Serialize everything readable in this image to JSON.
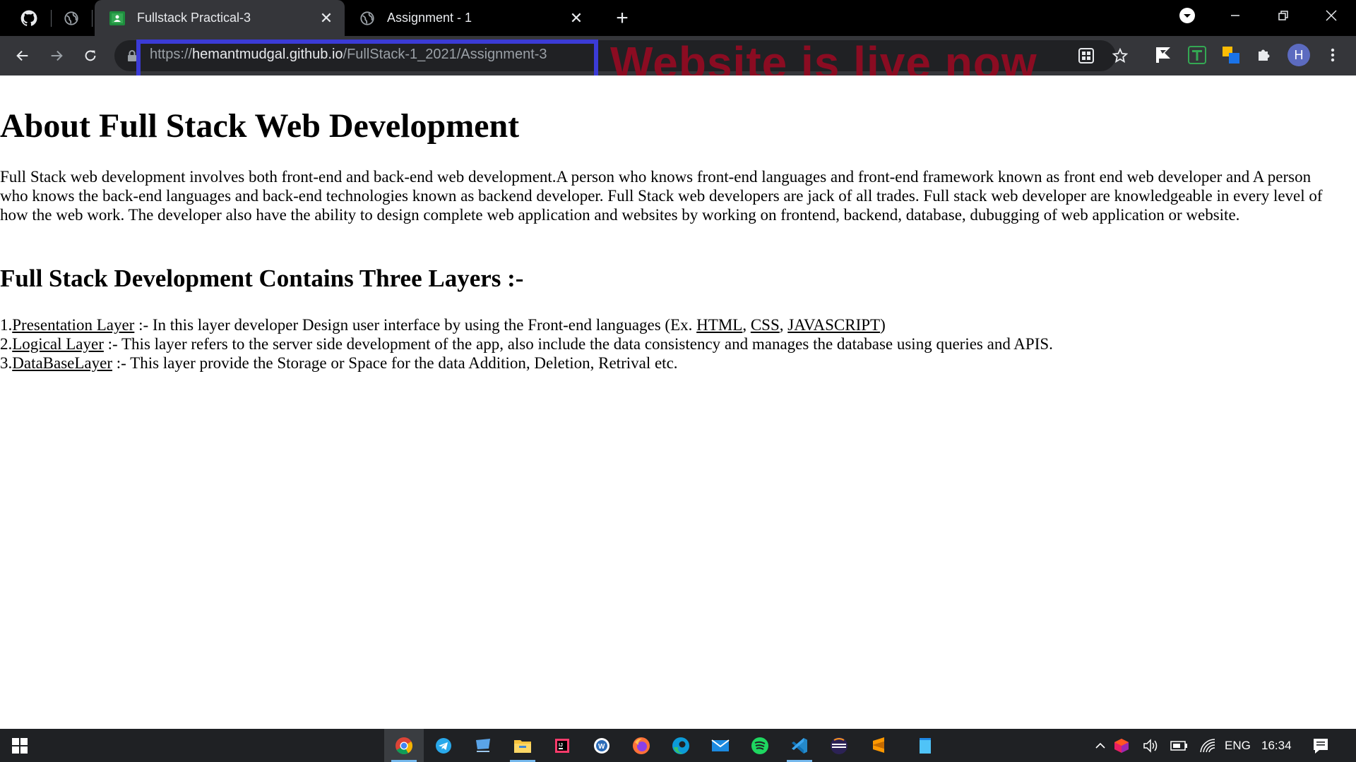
{
  "browser": {
    "tabs": [
      {
        "title": "Fullstack Practical-3",
        "favicon": "google-classroom-icon",
        "active": true
      },
      {
        "title": "Assignment - 1",
        "favicon": "globe-icon",
        "active": false
      }
    ],
    "pinned": [
      "github-icon",
      "globe-icon"
    ],
    "address": {
      "scheme": "https://",
      "host": "hemantmudgal.github.io",
      "path": "/FullStack-1_2021/Assignment-3"
    },
    "profile_initial": "H",
    "annotation": "Website is live now",
    "annotation_color": "#8b0c22",
    "highlight_color": "#3b3bd6"
  },
  "page": {
    "heading": "About Full Stack Web Development",
    "intro": "Full Stack web development involves both front-end and back-end web development.A person who knows front-end languages and front-end framework known as front end web developer and A person who knows the back-end languages and back-end technologies known as backend developer. Full Stack web developers are jack of all trades. Full stack web developer are knowledgeable in every level of how the web work. The developer also have the ability to design complete web application and websites by working on frontend, backend, database, dubugging of web application or website.",
    "subheading": "Full Stack Development Contains Three Layers :-",
    "layers": [
      {
        "number": "1.",
        "link": "Presentation Layer",
        "text_before": " :- In this layer developer Design user interface by using the Front-end languages (Ex. ",
        "tech_links": [
          "HTML",
          "CSS",
          "JAVASCRIPT"
        ],
        "text_after": ")"
      },
      {
        "number": "2.",
        "link": "Logical Layer",
        "text_before": " :- This layer refers to the server side development of the app, also include the data consistency and manages the database using queries and APIS."
      },
      {
        "number": "3.",
        "link": "DataBaseLayer",
        "text_before": " :- This layer provide the Storage or Space for the data Addition, Deletion, Retrival etc."
      }
    ]
  },
  "taskbar": {
    "apps": [
      "chrome-icon",
      "telegram-icon",
      "remote-desktop-icon",
      "file-explorer-icon",
      "intellij-icon",
      "word-pad-icon",
      "firefox-icon",
      "edge-icon",
      "mail-icon",
      "spotify-icon",
      "vscode-icon",
      "eclipse-icon",
      "sublime-icon",
      "notepad-icon"
    ],
    "language": "ENG",
    "time": "16:34"
  }
}
